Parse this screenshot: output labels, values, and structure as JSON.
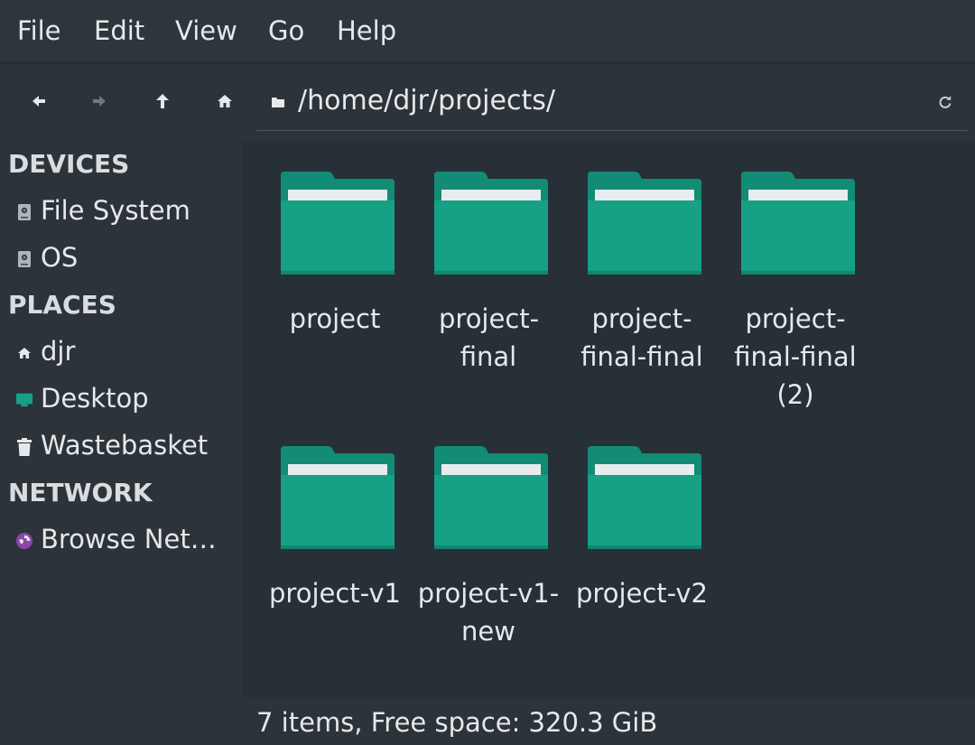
{
  "menubar": {
    "items": [
      "File",
      "Edit",
      "View",
      "Go",
      "Help"
    ]
  },
  "toolbar": {
    "back_icon": "arrow-left-icon",
    "forward_icon": "arrow-right-icon",
    "up_icon": "arrow-up-icon",
    "home_icon": "home-icon",
    "path": "/home/djr/projects/",
    "reload_icon": "reload-icon"
  },
  "sidebar": {
    "devices_heading": "DEVICES",
    "devices": [
      {
        "label": "File System",
        "icon": "drive-icon"
      },
      {
        "label": "OS",
        "icon": "drive-icon"
      }
    ],
    "places_heading": "PLACES",
    "places": [
      {
        "label": "djr",
        "icon": "home-icon"
      },
      {
        "label": "Desktop",
        "icon": "desktop-icon"
      },
      {
        "label": "Wastebasket",
        "icon": "trash-icon"
      }
    ],
    "network_heading": "NETWORK",
    "network": [
      {
        "label": "Browse Net…",
        "icon": "network-icon"
      }
    ]
  },
  "files": [
    {
      "name": "project"
    },
    {
      "name": "project-final"
    },
    {
      "name": "project-final-final"
    },
    {
      "name": "project-final-final (2)"
    },
    {
      "name": "project-v1"
    },
    {
      "name": "project-v1-new"
    },
    {
      "name": "project-v2"
    }
  ],
  "status": {
    "text": "7 items, Free space: 320.3 GiB"
  },
  "colors": {
    "folder": "#16a085",
    "folder_tab": "#128c74",
    "paper": "#e8ecee"
  }
}
